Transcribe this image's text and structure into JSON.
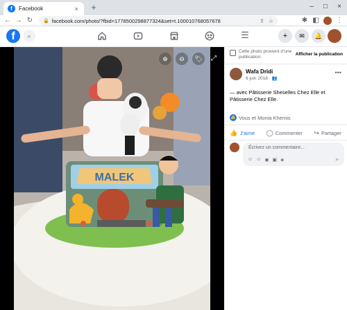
{
  "browser": {
    "tab_title": "Facebook",
    "tab_favicon": "f",
    "new_tab_label": "+",
    "url": "facebook.com/photo/?fbid=1778500298877324&set=t.100010768057678"
  },
  "icons": {
    "tab_close": "×",
    "minimize": "–",
    "maximize": "□",
    "close_window": "×",
    "back": "←",
    "forward": "→",
    "reload": "↻",
    "lock": "🔒",
    "share": "⇪",
    "star": "☆",
    "extensions": "✱",
    "sidebar": "◧",
    "menu_dots": "⋮",
    "fb_logo": "f",
    "search": "⌕",
    "menu": "☰",
    "create": "+",
    "messenger": "✉",
    "notifications": "🔔",
    "zoom_in": "⊕",
    "zoom_out": "⊖",
    "tag": "🏷",
    "fullscreen": "⤢",
    "more": "•••",
    "like_badge": "👍",
    "like": "👍",
    "comment": "◯",
    "share_post": "↪",
    "send": "➤",
    "audience": "👥",
    "comment_tools": [
      "☺",
      "☺",
      "◉",
      "▣",
      "◈"
    ]
  },
  "photo_panel": {
    "notice_text": "Cette photo provient d’une publication.",
    "notice_link": "Afficher la publication",
    "author_name": "Wafa Dridi",
    "post_date": "6 juin 2018 ·",
    "caption": "— avec Pâtisserie Sheselles Chez Elle et Pâtisserie Chez Elle.",
    "reactions_text": "Vous et Monia Khemis",
    "actions": {
      "like": "J’aime",
      "comment": "Commenter",
      "share": "Partager"
    },
    "comment_placeholder": "Écrivez un commentaire..."
  },
  "photo": {
    "cake_banner_text": "MALEK"
  },
  "colors": {
    "fb_blue": "#1877f2",
    "tabstrip": "#dee1e6"
  }
}
